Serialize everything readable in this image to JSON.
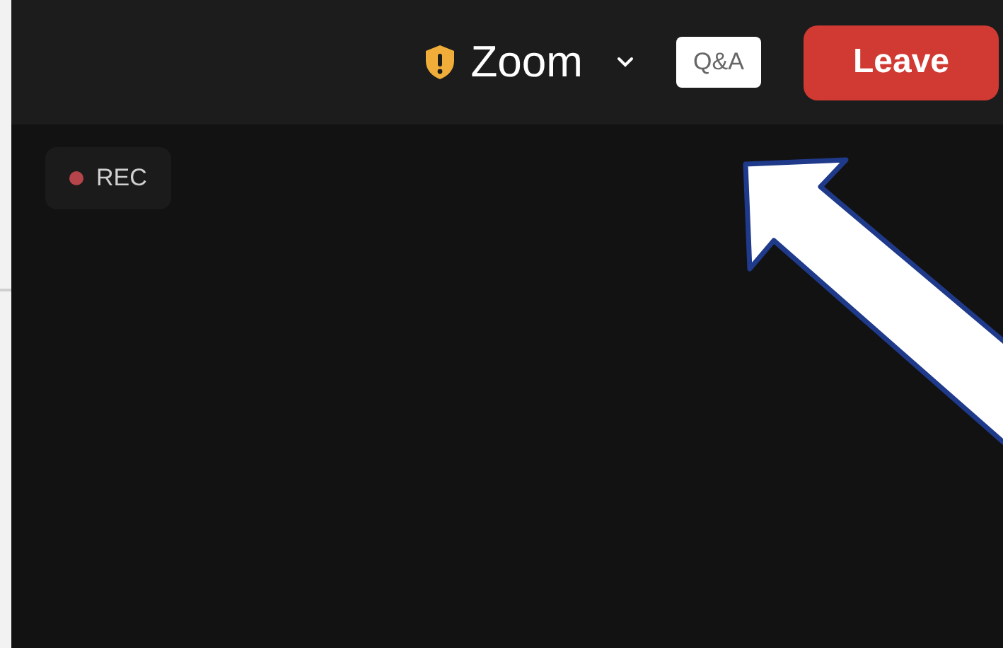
{
  "top_bar": {
    "meeting_title": "Zoom",
    "qa_button": "Q&A",
    "leave_button": "Leave"
  },
  "recording_badge": {
    "label": "REC"
  }
}
